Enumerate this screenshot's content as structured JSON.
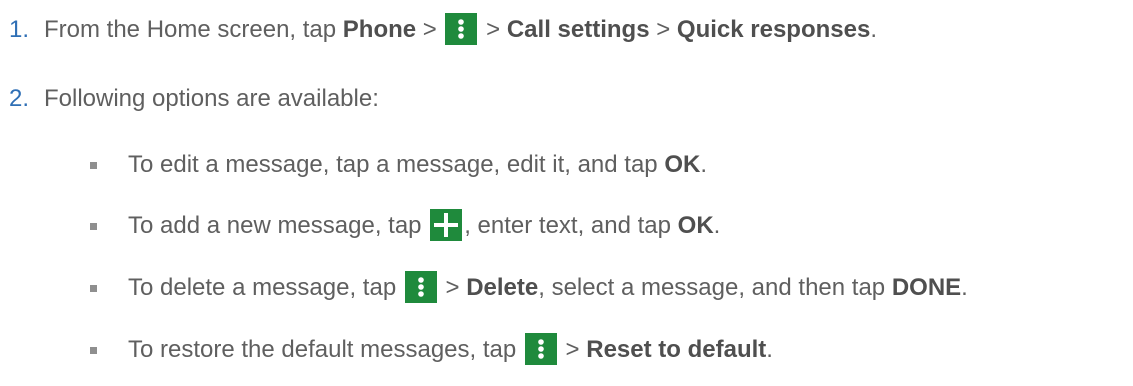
{
  "steps": [
    {
      "number": "1.",
      "segments": [
        {
          "text": "From the Home screen, tap ",
          "bold": false
        },
        {
          "text": "Phone",
          "bold": true
        },
        {
          "text": " > ",
          "bold": false
        },
        {
          "icon": "more-options-icon"
        },
        {
          "text": " > ",
          "bold": false
        },
        {
          "text": "Call settings",
          "bold": true
        },
        {
          "text": " > ",
          "bold": false
        },
        {
          "text": "Quick responses",
          "bold": true
        },
        {
          "text": ".",
          "bold": false
        }
      ]
    },
    {
      "number": "2.",
      "segments": [
        {
          "text": "Following options are available:",
          "bold": false
        }
      ]
    }
  ],
  "options": [
    {
      "segments": [
        {
          "text": "To edit a message, tap a message, edit it, and tap ",
          "bold": false
        },
        {
          "text": "OK",
          "bold": true
        },
        {
          "text": ".",
          "bold": false
        }
      ]
    },
    {
      "segments": [
        {
          "text": "To add a new message, tap ",
          "bold": false
        },
        {
          "icon": "add-icon"
        },
        {
          "text": ", enter text, and tap ",
          "bold": false
        },
        {
          "text": "OK",
          "bold": true
        },
        {
          "text": ".",
          "bold": false
        }
      ]
    },
    {
      "segments": [
        {
          "text": "To delete a message, tap ",
          "bold": false
        },
        {
          "icon": "more-options-icon"
        },
        {
          "text": " > ",
          "bold": false
        },
        {
          "text": "Delete",
          "bold": true
        },
        {
          "text": ", select a message, and then tap ",
          "bold": false
        },
        {
          "text": "DONE",
          "bold": true
        },
        {
          "text": ".",
          "bold": false
        }
      ]
    },
    {
      "segments": [
        {
          "text": "To restore the default messages, tap ",
          "bold": false
        },
        {
          "icon": "more-options-icon"
        },
        {
          "text": " > ",
          "bold": false
        },
        {
          "text": "Reset to default",
          "bold": true
        },
        {
          "text": ".",
          "bold": false
        }
      ]
    }
  ],
  "colors": {
    "text": "#5f5f5f",
    "number": "#2f6fb5",
    "icon_background": "#1f8a3c",
    "icon_foreground": "#ffffff",
    "bullet": "#8f8f8f"
  }
}
